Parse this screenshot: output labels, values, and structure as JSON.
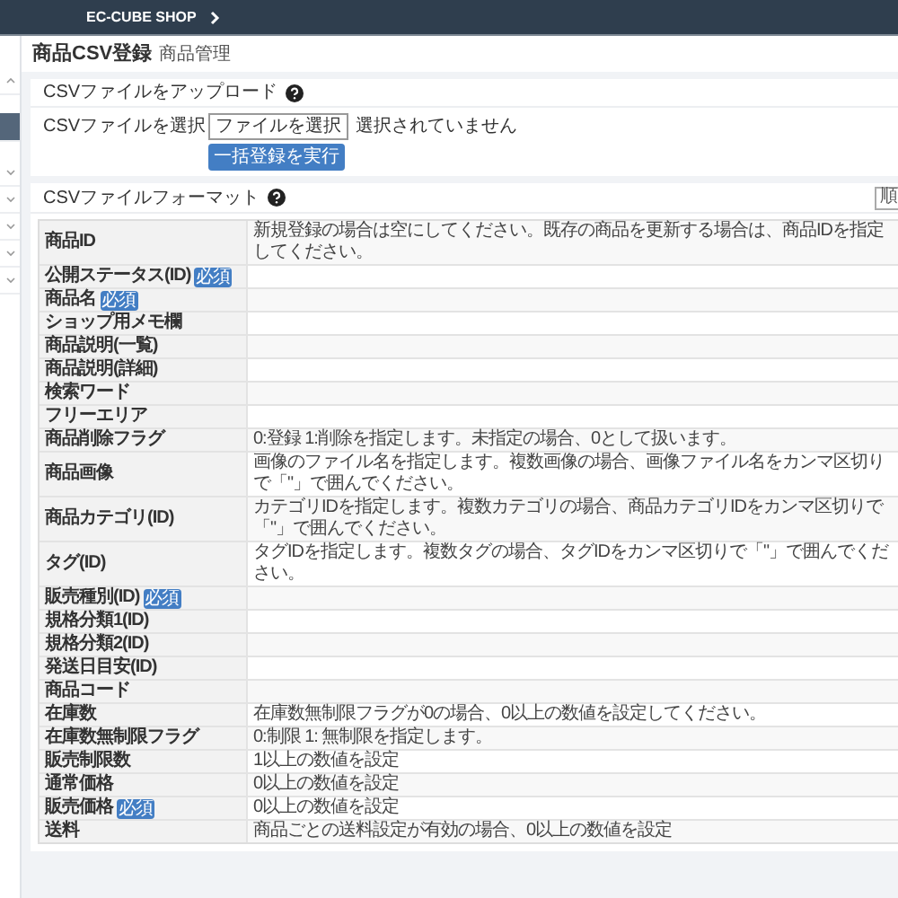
{
  "header": {
    "shop_name": "EC-CUBE SHOP"
  },
  "sidebar": {
    "items": [
      {
        "selected": false,
        "expanded": true
      },
      {
        "selected": true
      },
      {
        "selected": false,
        "expanded": false
      },
      {
        "selected": false,
        "expanded": false
      },
      {
        "selected": false,
        "expanded": false
      },
      {
        "selected": false,
        "expanded": false
      },
      {
        "selected": false,
        "expanded": false
      }
    ]
  },
  "page": {
    "title": "商品CSV登録",
    "subtitle": "商品管理"
  },
  "upload_card": {
    "title": "CSVファイルをアップロード",
    "field_label": "CSVファイルを選択",
    "file_button": "ファイルを選択",
    "file_status": "選択されていません",
    "submit_button": "一括登録を実行"
  },
  "format_card": {
    "title": "CSVファイルフォーマット",
    "corner_button": "順",
    "rows": [
      {
        "label": "商品ID",
        "description": "新規登録の場合は空にしてください。既存の商品を更新する場合は、商品IDを指定してください。"
      },
      {
        "label": "公開ステータス(ID)",
        "badge": "必須"
      },
      {
        "label": "商品名",
        "badge": "必須"
      },
      {
        "label": "ショップ用メモ欄"
      },
      {
        "label": "商品説明(一覧)"
      },
      {
        "label": "商品説明(詳細)"
      },
      {
        "label": "検索ワード"
      },
      {
        "label": "フリーエリア"
      },
      {
        "label": "商品削除フラグ",
        "description": "0:登録 1:削除を指定します。未指定の場合、0として扱います。"
      },
      {
        "label": "商品画像",
        "description": "画像のファイル名を指定します。複数画像の場合、画像ファイル名をカンマ区切りで「\"」で囲んでください。"
      },
      {
        "label": "商品カテゴリ(ID)",
        "description": "カテゴリIDを指定します。複数カテゴリの場合、商品カテゴリIDをカンマ区切りで「\"」で囲んでください。"
      },
      {
        "label": "タグ(ID)",
        "description": "タグIDを指定します。複数タグの場合、タグIDをカンマ区切りで「\"」で囲んでください。"
      },
      {
        "label": "販売種別(ID)",
        "badge": "必須"
      },
      {
        "label": "規格分類1(ID)"
      },
      {
        "label": "規格分類2(ID)"
      },
      {
        "label": "発送日目安(ID)"
      },
      {
        "label": "商品コード"
      },
      {
        "label": "在庫数",
        "description": "在庫数無制限フラグが0の場合、0以上の数値を設定してください。"
      },
      {
        "label": "在庫数無制限フラグ",
        "description": "0:制限 1: 無制限を指定します。"
      },
      {
        "label": "販売制限数",
        "description": "1以上の数値を設定"
      },
      {
        "label": "通常価格",
        "description": "0以上の数値を設定"
      },
      {
        "label": "販売価格",
        "badge": "必須",
        "description": "0以上の数値を設定"
      },
      {
        "label": "送料",
        "description": "商品ごとの送料設定が有効の場合、0以上の数値を設定"
      }
    ]
  }
}
